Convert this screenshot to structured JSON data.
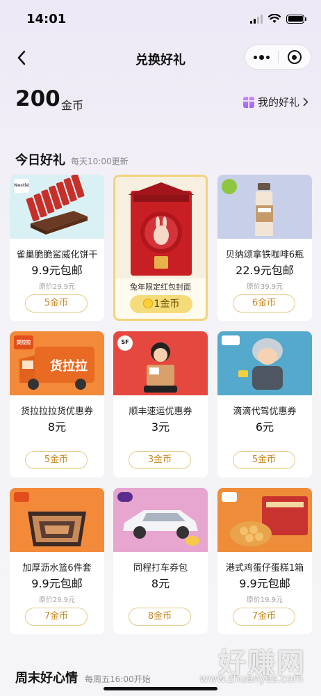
{
  "status_bar": {
    "time": "14:01"
  },
  "nav": {
    "title": "兑换好礼"
  },
  "coins": {
    "amount": "200",
    "unit": "金币",
    "my_gifts_label": "我的好礼"
  },
  "today_section": {
    "title": "今日好礼",
    "subtitle": "每天10:00更新"
  },
  "weekend_section": {
    "title": "周末好心情",
    "subtitle": "每周五16:00开始"
  },
  "cards": [
    {
      "name": "雀巢脆脆鲨威化饼干",
      "price": "9.9元包邮",
      "original": "原价29.9元",
      "cost": "5金币",
      "image": "wafer-image",
      "badge": "Nestlé"
    },
    {
      "name": "兔年限定红包封面",
      "price": "",
      "original": "",
      "cost": "1金币",
      "image": "red-packet-image",
      "badge": ""
    },
    {
      "name": "贝纳颂拿铁咖啡6瓶",
      "price": "22.9元包邮",
      "original": "原价39.9元",
      "cost": "6金币",
      "image": "coffee-image",
      "badge": ""
    },
    {
      "name": "货拉拉拉货优惠券",
      "price": "8元",
      "original": "",
      "cost": "5金币",
      "image": "truck-image",
      "badge": "货拉拉"
    },
    {
      "name": "顺丰速运优惠券",
      "price": "3元",
      "original": "",
      "cost": "3金币",
      "image": "courier-image",
      "badge": "SF"
    },
    {
      "name": "滴滴代驾优惠券",
      "price": "6元",
      "original": "",
      "cost": "5金币",
      "image": "driver-image",
      "badge": ""
    },
    {
      "name": "加厚沥水篮6件套",
      "price": "9.9元包邮",
      "original": "原价29.9元",
      "cost": "7金币",
      "image": "basket-image",
      "badge": ""
    },
    {
      "name": "同程打车券包",
      "price": "8元",
      "original": "",
      "cost": "8金币",
      "image": "car-image",
      "badge": ""
    },
    {
      "name": "港式鸡蛋仔蛋糕1箱",
      "price": "9.9元包邮",
      "original": "原价19.9元",
      "cost": "7金币",
      "image": "cake-image",
      "badge": ""
    }
  ],
  "watermark": {
    "text": "好赚网",
    "url": "www.zhuanyes.com"
  },
  "colors": {
    "accent_gold": "#c9861e",
    "button_border": "#e6c98a",
    "highlight_border": "#f2d37a"
  }
}
